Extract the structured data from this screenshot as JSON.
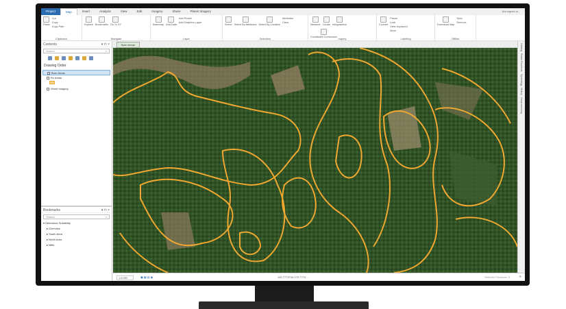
{
  "ribbon": {
    "tabs": [
      "Project",
      "Map",
      "Insert",
      "Analysis",
      "View",
      "Edit",
      "Imagery",
      "Share",
      "Planet Imagery"
    ],
    "active_tab": "Map",
    "user": "Not signed in",
    "groups": [
      {
        "label": "Clipboard",
        "buttons": [
          "Paste"
        ],
        "small": [
          "Cut",
          "Copy",
          "Copy Path"
        ]
      },
      {
        "label": "Navigate",
        "buttons": [
          "Explore",
          "Bookmarks",
          "Go To XY"
        ],
        "small": []
      },
      {
        "label": "Layer",
        "buttons": [
          "Basemap",
          "Add Data"
        ],
        "small": [
          "Add Preset",
          "Add Graphics Layer"
        ]
      },
      {
        "label": "Selection",
        "buttons": [
          "Select",
          "Select By Attributes",
          "Select By Location"
        ],
        "small": [
          "Attributes",
          "Clear"
        ]
      },
      {
        "label": "Inquiry",
        "buttons": [
          "Measure",
          "Locate",
          "Infographics",
          "Coordinate Conversion"
        ],
        "small": []
      },
      {
        "label": "Labeling",
        "buttons": [
          "Convert"
        ],
        "small": [
          "Pause",
          "Lock",
          "View Unplaced",
          "More"
        ]
      },
      {
        "label": "Offline",
        "buttons": [
          "Download Map"
        ],
        "small": [
          "Sync",
          "Remove"
        ]
      }
    ]
  },
  "contents": {
    "title": "Contents",
    "search_placeholder": "Search",
    "subtitle": "Drawing Order",
    "layers": [
      {
        "name": "Burn Areas",
        "selected": true
      },
      {
        "name": "Rx Areas",
        "selected": false
      },
      {
        "name": "World Imagery",
        "selected": false
      }
    ]
  },
  "bookmarks": {
    "title": "Bookmarks",
    "search_placeholder": "Search",
    "group": "Determine Suitability",
    "items": [
      "Overview",
      "South Area",
      "North Area",
      "Mills"
    ]
  },
  "map": {
    "tab": "Burn Areas",
    "boundary_color": "#f0a830"
  },
  "right_tabs": [
    "Catalog",
    "Raster Functions",
    "Symbology",
    "History",
    "Geoprocessing"
  ],
  "status": {
    "scale": "1:8,952",
    "coordinates": "100.7773734 170.7774 ...",
    "selected": "Selected Features: 0"
  }
}
